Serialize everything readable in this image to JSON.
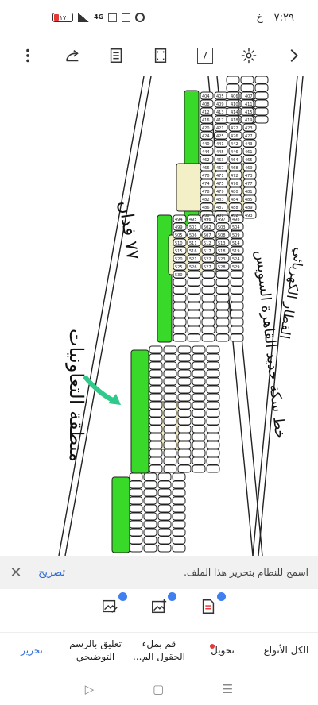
{
  "status_bar": {
    "time": "٧:٢٩",
    "carrier_letter": "خ",
    "battery_level": "١٧",
    "network": "4G",
    "icons": [
      "battery-icon",
      "signal-icon",
      "network-4g-icon",
      "sim-icon",
      "screenshot-icon",
      "alarm-icon"
    ]
  },
  "toolbar": {
    "page_number": "7",
    "icons": [
      "more-vert-icon",
      "share-icon",
      "reading-mode-icon",
      "fit-screen-icon",
      "page-number-icon",
      "brightness-icon",
      "chevron-right-icon"
    ]
  },
  "map": {
    "street_label": "٧٧ فدان",
    "zone_label": "منطقة التعاونيات",
    "railway_label": "خط سكة حديد القاهرة السويس",
    "railway_label_top": "القطار الكهربائي",
    "lot_numbers": [
      "404",
      "405",
      "406",
      "407",
      "408",
      "409",
      "410",
      "411",
      "412",
      "413",
      "414",
      "415",
      "416",
      "417",
      "418",
      "419",
      "420",
      "421",
      "422",
      "423",
      "424",
      "425",
      "426",
      "427",
      "440",
      "441",
      "442",
      "443",
      "444",
      "445",
      "446",
      "461",
      "462",
      "463",
      "464",
      "465",
      "466",
      "467",
      "468",
      "469",
      "470",
      "471",
      "472",
      "473",
      "474",
      "475",
      "476",
      "477",
      "478",
      "479",
      "480",
      "481",
      "482",
      "483",
      "484",
      "485",
      "486",
      "487",
      "488",
      "489",
      "490",
      "491",
      "492",
      "493",
      "494",
      "495",
      "496",
      "497",
      "498",
      "499",
      "501",
      "502",
      "503",
      "504",
      "505",
      "506",
      "507",
      "508",
      "509",
      "510",
      "511",
      "512",
      "513",
      "514",
      "515",
      "516",
      "517",
      "518",
      "519",
      "520",
      "521",
      "522",
      "523",
      "524",
      "525",
      "526",
      "527",
      "528",
      "529",
      "530"
    ],
    "colors": {
      "green": "#38d928",
      "cream": "#f3efc7",
      "line": "#222222",
      "arrow": "#2fc98c"
    }
  },
  "banner": {
    "message": "اسمح للنظام بتحرير هذا الملف.",
    "action": "تصريح"
  },
  "tools": {
    "icons": [
      "annotate-image-icon",
      "add-image-icon",
      "fill-form-icon"
    ]
  },
  "tabs": [
    {
      "label": "تحرير"
    },
    {
      "label": "تعليق بالرسم التوضيحي"
    },
    {
      "label": "قم بملء الحقول الم..."
    },
    {
      "label": "تحويل"
    },
    {
      "label": "الكل الأنواع"
    }
  ],
  "nav": {
    "icons": [
      "back-triangle-icon",
      "home-square-icon",
      "menu-lines-icon"
    ]
  }
}
